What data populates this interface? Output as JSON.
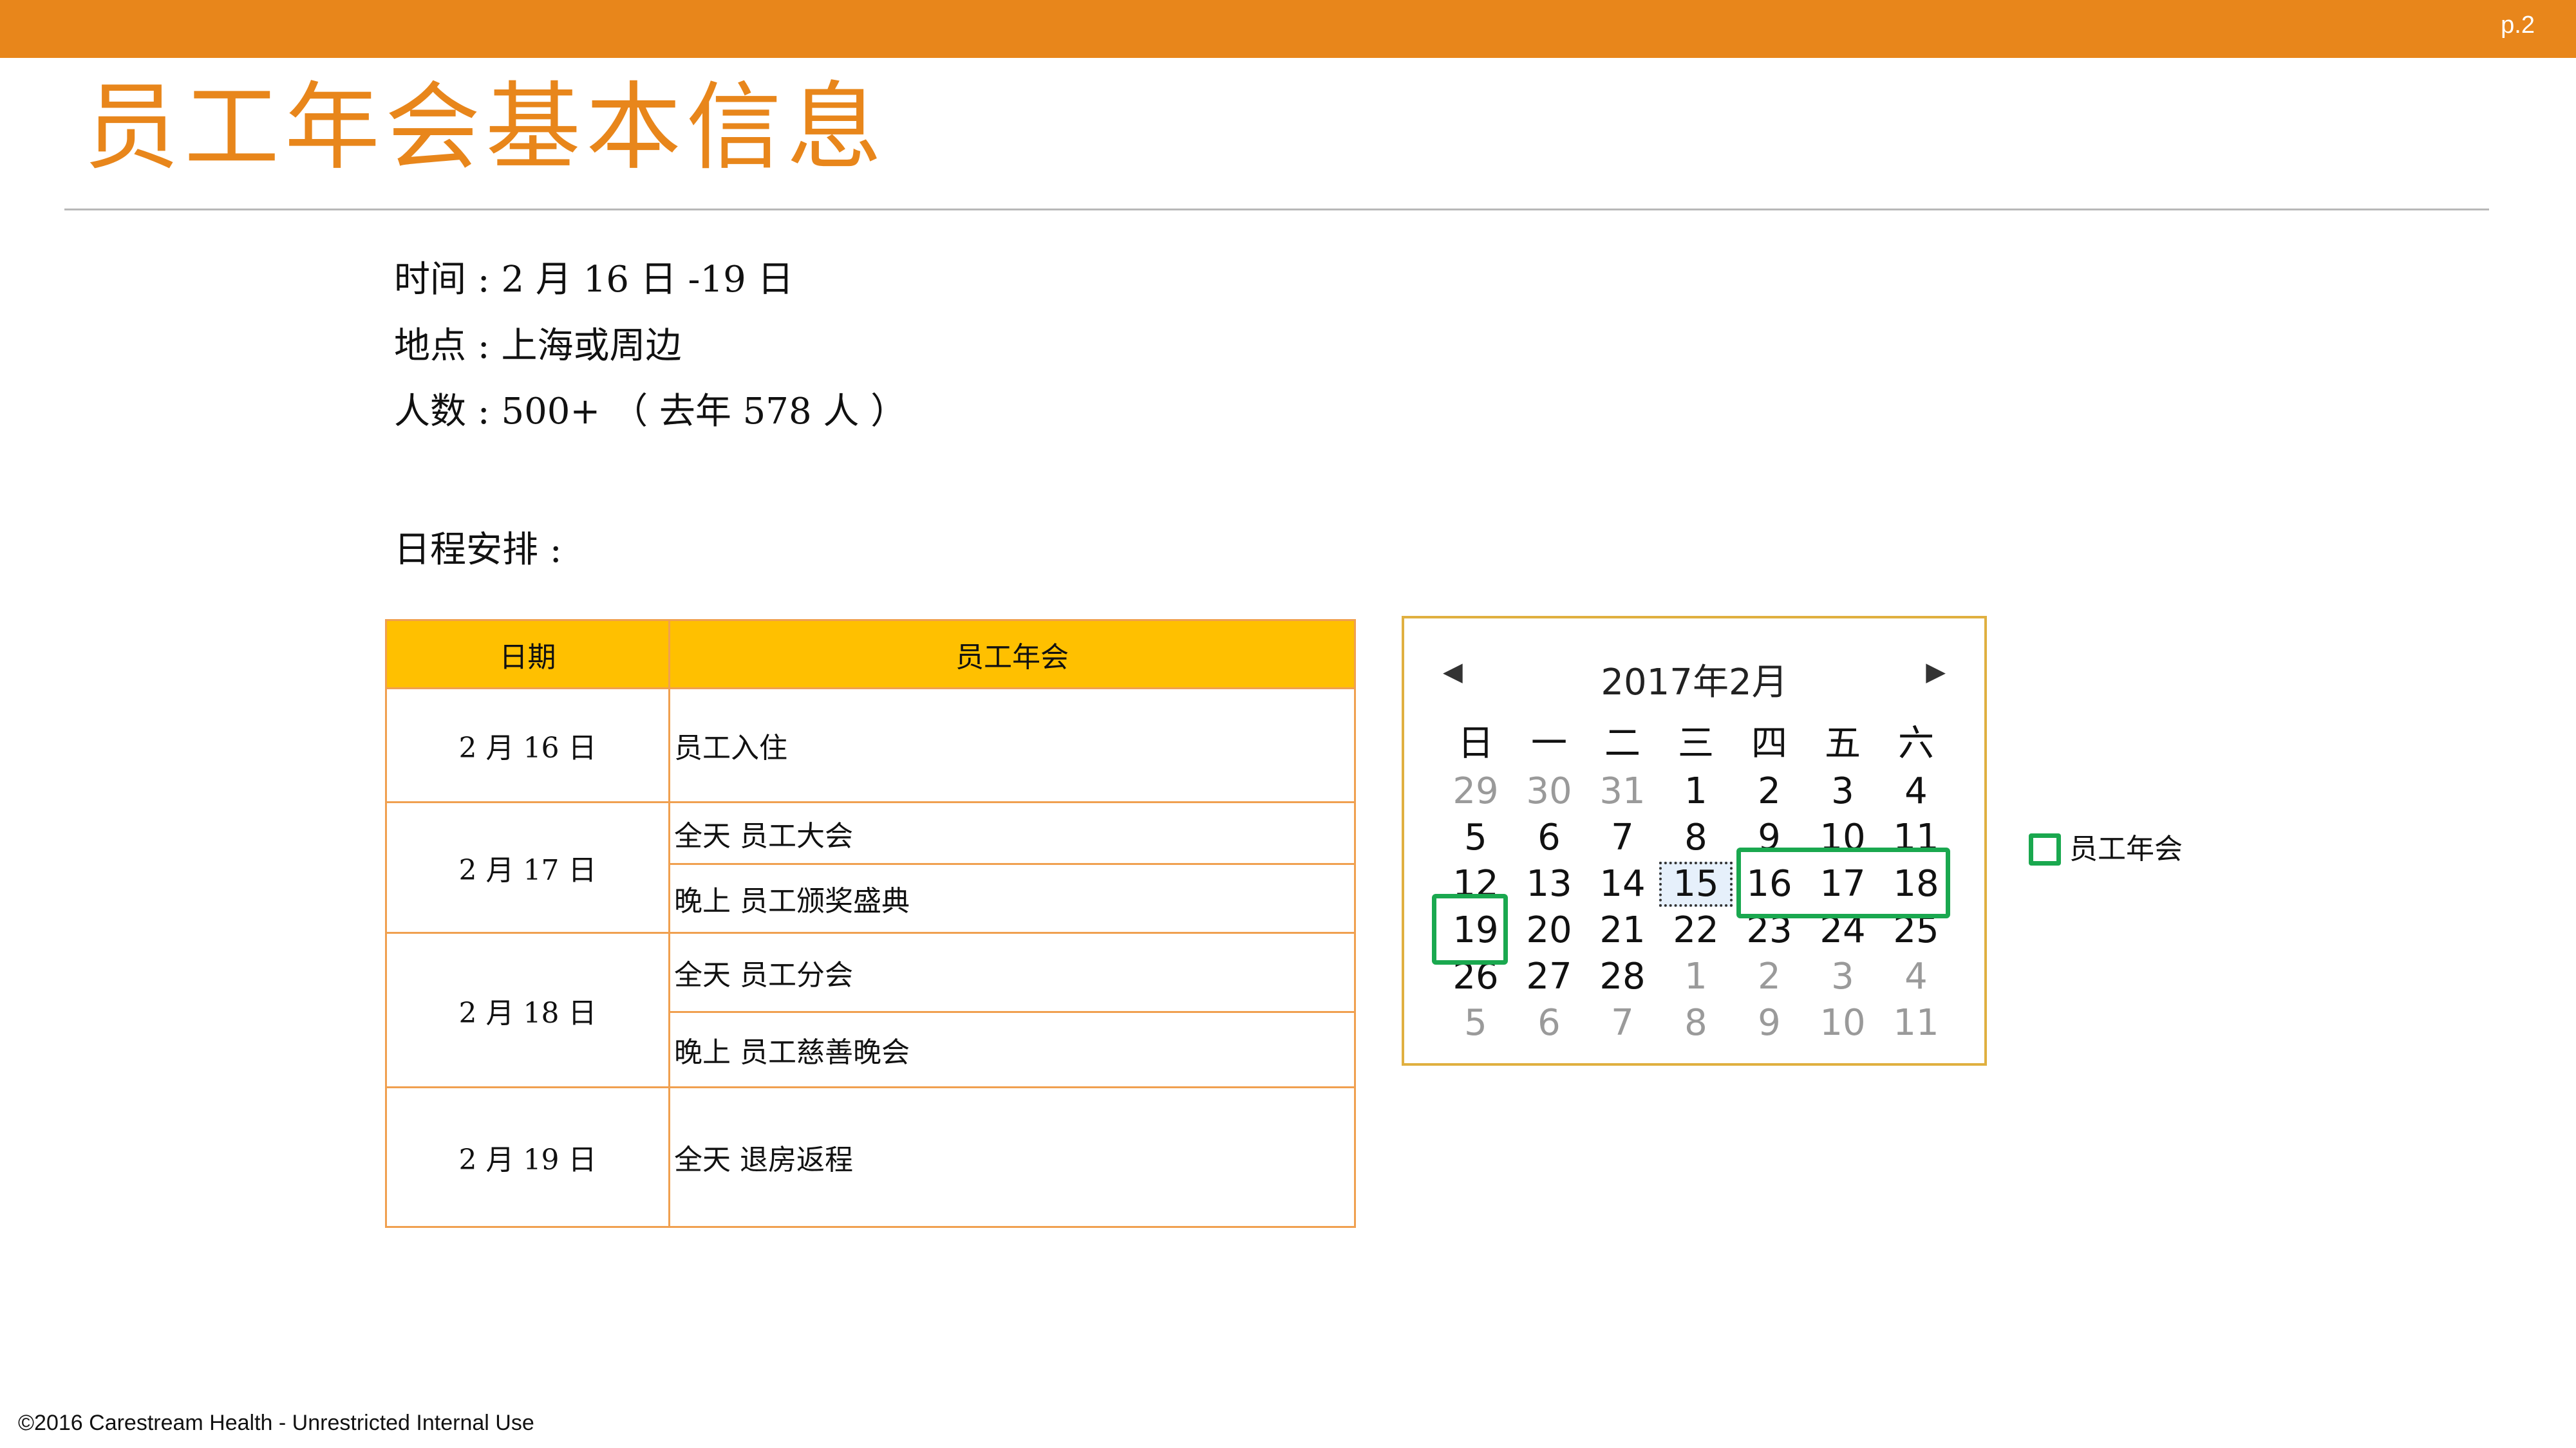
{
  "page": {
    "number": "p.2",
    "title": "员工年会基本信息"
  },
  "info": {
    "time": "时间 : 2 月 16 日 -19 日",
    "location": "地点 :  上海或周边",
    "people": "人数 : 500+ （ 去年 578 人 ）",
    "schedule_label": "日程安排 :"
  },
  "schedule": {
    "headers": [
      "日期",
      "员工年会"
    ],
    "rows": [
      {
        "date": "2 月 16 日",
        "items": [
          "员工入住"
        ]
      },
      {
        "date": "2 月 17 日",
        "items": [
          "全天  员工大会",
          "晚上  员工颁奖盛典"
        ]
      },
      {
        "date": "2 月 18 日",
        "items": [
          "全天  员工分会",
          "晚上  员工慈善晚会"
        ]
      },
      {
        "date": "2 月 19 日",
        "items": [
          "全天  退房返程"
        ]
      }
    ]
  },
  "calendar": {
    "title": "2017年2月",
    "weekdays": [
      "日",
      "一",
      "二",
      "三",
      "四",
      "五",
      "六"
    ],
    "weeks": [
      [
        "29",
        "30",
        "31",
        "1",
        "2",
        "3",
        "4"
      ],
      [
        "5",
        "6",
        "7",
        "8",
        "9",
        "10",
        "11"
      ],
      [
        "12",
        "13",
        "14",
        "15",
        "16",
        "17",
        "18"
      ],
      [
        "19",
        "20",
        "21",
        "22",
        "23",
        "24",
        "25"
      ],
      [
        "26",
        "27",
        "28",
        "1",
        "2",
        "3",
        "4"
      ],
      [
        "5",
        "6",
        "7",
        "8",
        "9",
        "10",
        "11"
      ]
    ],
    "today": "15",
    "highlighted_days": [
      "16",
      "17",
      "18",
      "19"
    ],
    "highlight_color": "#1aa84f"
  },
  "legend": {
    "label": "员工年会"
  },
  "footer": "©2016 Carestream Health - Unrestricted Internal Use",
  "colors": {
    "accent": "#e8861b",
    "table_header": "#ffc000",
    "table_border": "#f0a050"
  }
}
